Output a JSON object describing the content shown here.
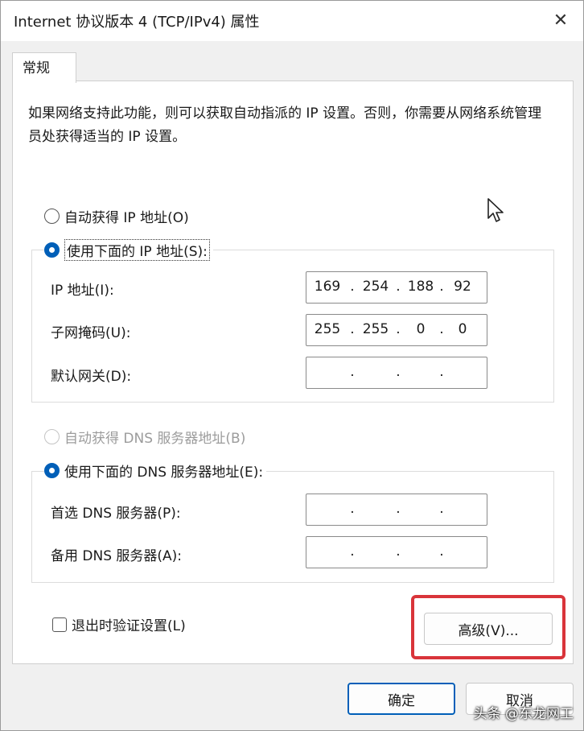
{
  "window": {
    "title": "Internet 协议版本 4 (TCP/IPv4) 属性",
    "close_glyph": "✕"
  },
  "tabs": [
    {
      "label": "常规"
    }
  ],
  "description": "如果网络支持此功能，则可以获取自动指派的 IP 设置。否则，你需要从网络系统管理员处获得适当的 IP 设置。",
  "ip_section": {
    "auto_label": "自动获得 IP 地址(O)",
    "manual_label": "使用下面的 IP 地址(S):",
    "selected": "manual",
    "fields": [
      {
        "label": "IP 地址(I):",
        "octets": [
          "169",
          "254",
          "188",
          "92"
        ]
      },
      {
        "label": "子网掩码(U):",
        "octets": [
          "255",
          "255",
          "0",
          "0"
        ]
      },
      {
        "label": "默认网关(D):",
        "octets": [
          "",
          "",
          "",
          ""
        ]
      }
    ]
  },
  "dns_section": {
    "auto_label": "自动获得 DNS 服务器地址(B)",
    "manual_label": "使用下面的 DNS 服务器地址(E):",
    "selected": "manual",
    "fields": [
      {
        "label": "首选 DNS 服务器(P):",
        "octets": [
          "",
          "",
          "",
          ""
        ]
      },
      {
        "label": "备用 DNS 服务器(A):",
        "octets": [
          "",
          "",
          "",
          ""
        ]
      }
    ]
  },
  "validate_checkbox": {
    "label": "退出时验证设置(L)",
    "checked": false
  },
  "buttons": {
    "advanced": "高级(V)...",
    "ok": "确定",
    "cancel": "取消"
  },
  "watermark": "头条 @东龙网工",
  "colors": {
    "accent": "#005fb8",
    "highlight": "#d9343a"
  }
}
